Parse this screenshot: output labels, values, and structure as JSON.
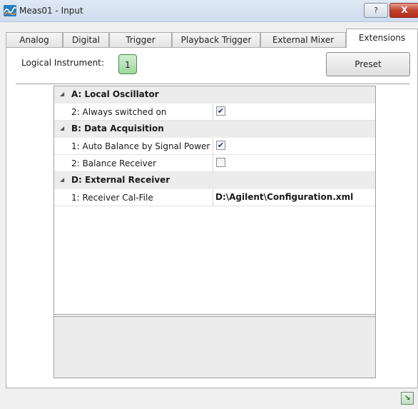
{
  "window": {
    "title": "Meas01 - Input",
    "help_label": "?",
    "close_label": "X"
  },
  "tabs": [
    {
      "label": "Analog"
    },
    {
      "label": "Digital"
    },
    {
      "label": "Trigger"
    },
    {
      "label": "Playback Trigger"
    },
    {
      "label": "External Mixer"
    },
    {
      "label": "Extensions",
      "active": true
    }
  ],
  "header": {
    "logical_instrument_label": "Logical Instrument:",
    "logical_instrument_value": "1",
    "preset_label": "Preset"
  },
  "grid": {
    "categories": [
      {
        "label": "A: Local Oscillator",
        "properties": [
          {
            "label": "2: Always switched on",
            "checked": true
          }
        ]
      },
      {
        "label": "B: Data Acquisition",
        "properties": [
          {
            "label": "1: Auto Balance by Signal Power",
            "checked": true
          },
          {
            "label": "2: Balance Receiver",
            "checked": false
          }
        ]
      },
      {
        "label": "D: External Receiver",
        "properties": [
          {
            "label": "1: Receiver Cal-File",
            "value": "D:\\Agilent\\Configuration.xml"
          }
        ]
      }
    ]
  },
  "icons": {
    "app": "waveform-icon",
    "expand": "expand-arrow-icon",
    "resize": "resize-grip-icon"
  },
  "colors": {
    "accent_green": "#9fd7a0",
    "close_red": "#c2412f"
  }
}
